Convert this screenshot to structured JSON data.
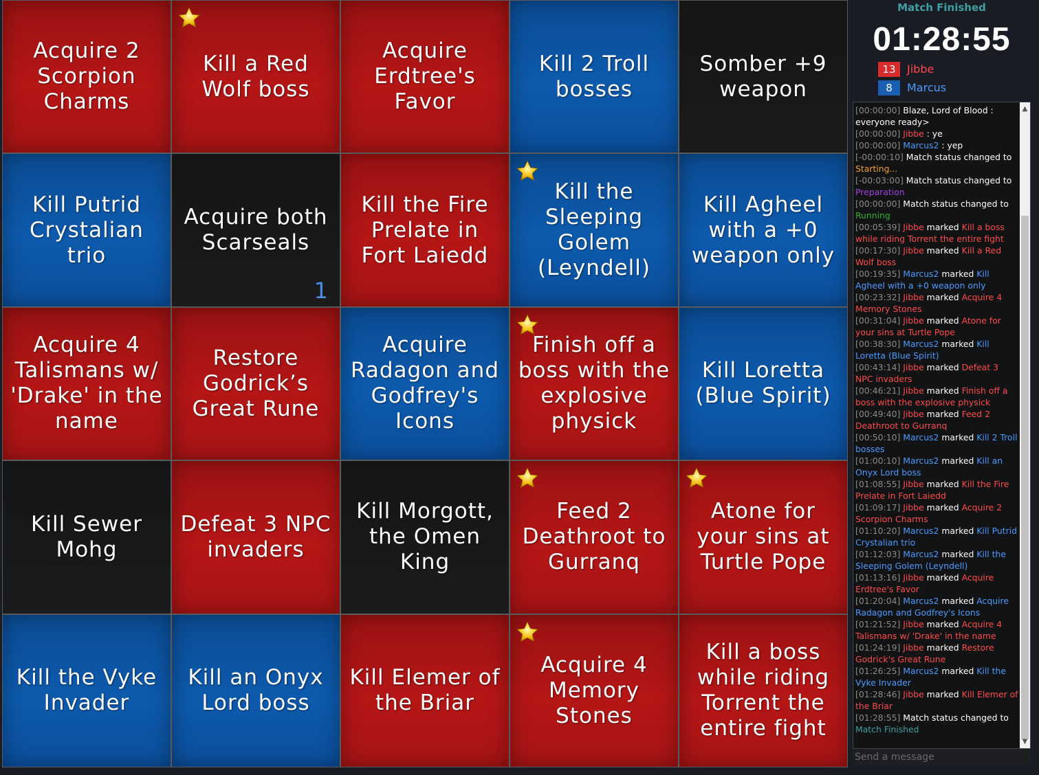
{
  "board": {
    "cells": [
      {
        "text": "Acquire 2 Scorpion Charms",
        "color": "red",
        "star": false,
        "counter": ""
      },
      {
        "text": "Kill a Red Wolf boss",
        "color": "red",
        "star": true,
        "counter": ""
      },
      {
        "text": "Acquire Erdtree's Favor",
        "color": "red",
        "star": false,
        "counter": ""
      },
      {
        "text": "Kill 2 Troll bosses",
        "color": "blue",
        "star": false,
        "counter": ""
      },
      {
        "text": "Somber +9 weapon",
        "color": "black",
        "star": false,
        "counter": ""
      },
      {
        "text": "Kill Putrid Crystalian trio",
        "color": "blue",
        "star": false,
        "counter": ""
      },
      {
        "text": "Acquire both Scarseals",
        "color": "black",
        "star": false,
        "counter": "1"
      },
      {
        "text": "Kill the Fire Prelate in Fort Laiedd",
        "color": "red",
        "star": false,
        "counter": ""
      },
      {
        "text": "Kill the Sleeping Golem (Leyndell)",
        "color": "blue",
        "star": true,
        "counter": ""
      },
      {
        "text": "Kill Agheel with a +0 weapon only",
        "color": "blue",
        "star": false,
        "counter": ""
      },
      {
        "text": "Acquire 4 Talismans w/ 'Drake' in the name",
        "color": "red",
        "star": false,
        "counter": ""
      },
      {
        "text": "Restore Godrick’s Great Rune",
        "color": "red",
        "star": false,
        "counter": ""
      },
      {
        "text": "Acquire Radagon and Godfrey's Icons",
        "color": "blue",
        "star": false,
        "counter": ""
      },
      {
        "text": "Finish off a boss with the explosive physick",
        "color": "red",
        "star": true,
        "counter": ""
      },
      {
        "text": "Kill Loretta (Blue Spirit)",
        "color": "blue",
        "star": false,
        "counter": ""
      },
      {
        "text": "Kill Sewer Mohg",
        "color": "black",
        "star": false,
        "counter": ""
      },
      {
        "text": "Defeat 3 NPC invaders",
        "color": "red",
        "star": false,
        "counter": ""
      },
      {
        "text": "Kill Morgott, the Omen King",
        "color": "black",
        "star": false,
        "counter": ""
      },
      {
        "text": "Feed 2 Deathroot to Gurranq",
        "color": "red",
        "star": true,
        "counter": ""
      },
      {
        "text": "Atone for your sins at Turtle Pope",
        "color": "red",
        "star": true,
        "counter": ""
      },
      {
        "text": "Kill the Vyke Invader",
        "color": "blue",
        "star": false,
        "counter": ""
      },
      {
        "text": "Kill an Onyx Lord boss",
        "color": "blue",
        "star": false,
        "counter": ""
      },
      {
        "text": "Kill Elemer of the Briar",
        "color": "red",
        "star": false,
        "counter": ""
      },
      {
        "text": "Acquire 4 Memory Stones",
        "color": "red",
        "star": true,
        "counter": ""
      },
      {
        "text": "Kill a boss while riding Torrent the entire fight",
        "color": "red",
        "star": false,
        "counter": ""
      }
    ]
  },
  "sidebar": {
    "status": "Match Finished",
    "timer": "01:28:55",
    "players": [
      {
        "score": "13",
        "name": "Jibbe",
        "color": "#d82b2b"
      },
      {
        "score": "8",
        "name": "Marcus",
        "color": "#1a5fb4"
      }
    ]
  },
  "colors": {
    "red_player": "#ff4a4a",
    "blue_player": "#4a9aff",
    "status_starting": "#f0a020",
    "status_preparation": "#a040e0",
    "status_running": "#30b030",
    "status_finished": "#3f9fa0"
  },
  "chat": {
    "placeholder": "Send a message",
    "messages": [
      {
        "ts": "[00:00:00]",
        "parts": [
          {
            "t": "Blaze, Lord of Blood : everyone ready>",
            "c": "w"
          }
        ]
      },
      {
        "ts": "[00:00:00]",
        "parts": [
          {
            "t": "Jibbe",
            "c": "r"
          },
          {
            "t": " : ye",
            "c": "w"
          }
        ]
      },
      {
        "ts": "[00:00:00]",
        "parts": [
          {
            "t": "Marcus2",
            "c": "b"
          },
          {
            "t": " : yep",
            "c": "w"
          }
        ]
      },
      {
        "ts": "[-00:00:10]",
        "parts": [
          {
            "t": "Match status changed to ",
            "c": "w"
          },
          {
            "t": "Starting...",
            "c": "o"
          }
        ]
      },
      {
        "ts": "[-00:03:00]",
        "parts": [
          {
            "t": "Match status changed to ",
            "c": "w"
          },
          {
            "t": "Preparation",
            "c": "p"
          }
        ]
      },
      {
        "ts": "[00:00:00]",
        "parts": [
          {
            "t": "Match status changed to ",
            "c": "w"
          },
          {
            "t": "Running",
            "c": "g"
          }
        ]
      },
      {
        "ts": "[00:05:39]",
        "parts": [
          {
            "t": "Jibbe",
            "c": "r"
          },
          {
            "t": " marked ",
            "c": "w"
          },
          {
            "t": "Kill a boss while riding Torrent the entire fight",
            "c": "r"
          }
        ]
      },
      {
        "ts": "[00:17:30]",
        "parts": [
          {
            "t": "Jibbe",
            "c": "r"
          },
          {
            "t": " marked ",
            "c": "w"
          },
          {
            "t": "Kill a Red Wolf boss",
            "c": "r"
          }
        ]
      },
      {
        "ts": "[00:19:35]",
        "parts": [
          {
            "t": "Marcus2",
            "c": "b"
          },
          {
            "t": " marked ",
            "c": "w"
          },
          {
            "t": "Kill Agheel with a +0 weapon only",
            "c": "b"
          }
        ]
      },
      {
        "ts": "[00:23:32]",
        "parts": [
          {
            "t": "Jibbe",
            "c": "r"
          },
          {
            "t": " marked ",
            "c": "w"
          },
          {
            "t": "Acquire 4 Memory Stones",
            "c": "r"
          }
        ]
      },
      {
        "ts": "[00:31:04]",
        "parts": [
          {
            "t": "Jibbe",
            "c": "r"
          },
          {
            "t": " marked ",
            "c": "w"
          },
          {
            "t": "Atone for your sins at Turtle Pope",
            "c": "r"
          }
        ]
      },
      {
        "ts": "[00:38:30]",
        "parts": [
          {
            "t": "Marcus2",
            "c": "b"
          },
          {
            "t": " marked ",
            "c": "w"
          },
          {
            "t": "Kill Loretta (Blue Spirit)",
            "c": "b"
          }
        ]
      },
      {
        "ts": "[00:43:14]",
        "parts": [
          {
            "t": "Jibbe",
            "c": "r"
          },
          {
            "t": " marked ",
            "c": "w"
          },
          {
            "t": "Defeat 3 NPC invaders",
            "c": "r"
          }
        ]
      },
      {
        "ts": "[00:46:21]",
        "parts": [
          {
            "t": "Jibbe",
            "c": "r"
          },
          {
            "t": " marked ",
            "c": "w"
          },
          {
            "t": "Finish off a boss with the explosive physick",
            "c": "r"
          }
        ]
      },
      {
        "ts": "[00:49:40]",
        "parts": [
          {
            "t": "Jibbe",
            "c": "r"
          },
          {
            "t": " marked ",
            "c": "w"
          },
          {
            "t": "Feed 2 Deathroot to Gurranq",
            "c": "r"
          }
        ]
      },
      {
        "ts": "[00:50:10]",
        "parts": [
          {
            "t": "Marcus2",
            "c": "b"
          },
          {
            "t": " marked ",
            "c": "w"
          },
          {
            "t": "Kill 2 Troll bosses",
            "c": "b"
          }
        ]
      },
      {
        "ts": "[01:00:10]",
        "parts": [
          {
            "t": "Marcus2",
            "c": "b"
          },
          {
            "t": " marked ",
            "c": "w"
          },
          {
            "t": "Kill an Onyx Lord boss",
            "c": "b"
          }
        ]
      },
      {
        "ts": "[01:08:55]",
        "parts": [
          {
            "t": "Jibbe",
            "c": "r"
          },
          {
            "t": " marked ",
            "c": "w"
          },
          {
            "t": "Kill the Fire Prelate in Fort Laiedd",
            "c": "r"
          }
        ]
      },
      {
        "ts": "[01:09:17]",
        "parts": [
          {
            "t": "Jibbe",
            "c": "r"
          },
          {
            "t": " marked ",
            "c": "w"
          },
          {
            "t": "Acquire 2 Scorpion Charms",
            "c": "r"
          }
        ]
      },
      {
        "ts": "[01:10:20]",
        "parts": [
          {
            "t": "Marcus2",
            "c": "b"
          },
          {
            "t": " marked ",
            "c": "w"
          },
          {
            "t": "Kill Putrid Crystalian trio",
            "c": "b"
          }
        ]
      },
      {
        "ts": "[01:12:03]",
        "parts": [
          {
            "t": "Marcus2",
            "c": "b"
          },
          {
            "t": " marked ",
            "c": "w"
          },
          {
            "t": "Kill the Sleeping Golem (Leyndell)",
            "c": "b"
          }
        ]
      },
      {
        "ts": "[01:13:16]",
        "parts": [
          {
            "t": "Jibbe",
            "c": "r"
          },
          {
            "t": " marked ",
            "c": "w"
          },
          {
            "t": "Acquire Erdtree's Favor",
            "c": "r"
          }
        ]
      },
      {
        "ts": "[01:20:04]",
        "parts": [
          {
            "t": "Marcus2",
            "c": "b"
          },
          {
            "t": " marked ",
            "c": "w"
          },
          {
            "t": "Acquire Radagon and Godfrey's Icons",
            "c": "b"
          }
        ]
      },
      {
        "ts": "[01:21:52]",
        "parts": [
          {
            "t": "Jibbe",
            "c": "r"
          },
          {
            "t": " marked ",
            "c": "w"
          },
          {
            "t": "Acquire 4 Talismans w/ 'Drake' in the name",
            "c": "r"
          }
        ]
      },
      {
        "ts": "[01:24:19]",
        "parts": [
          {
            "t": "Jibbe",
            "c": "r"
          },
          {
            "t": " marked ",
            "c": "w"
          },
          {
            "t": "Restore Godrick's Great Rune",
            "c": "r"
          }
        ]
      },
      {
        "ts": "[01:26:25]",
        "parts": [
          {
            "t": "Marcus2",
            "c": "b"
          },
          {
            "t": " marked ",
            "c": "w"
          },
          {
            "t": "Kill the Vyke Invader",
            "c": "b"
          }
        ]
      },
      {
        "ts": "[01:28:46]",
        "parts": [
          {
            "t": "Jibbe",
            "c": "r"
          },
          {
            "t": " marked ",
            "c": "w"
          },
          {
            "t": "Kill Elemer of the Briar",
            "c": "r"
          }
        ]
      },
      {
        "ts": "[01:28:55]",
        "parts": [
          {
            "t": "Match status changed to ",
            "c": "w"
          },
          {
            "t": "Match Finished",
            "c": "f"
          }
        ]
      }
    ]
  },
  "icons": {
    "star": "star-icon",
    "scroll_up": "scroll-up-arrow-icon",
    "scroll_down": "scroll-down-arrow-icon"
  }
}
